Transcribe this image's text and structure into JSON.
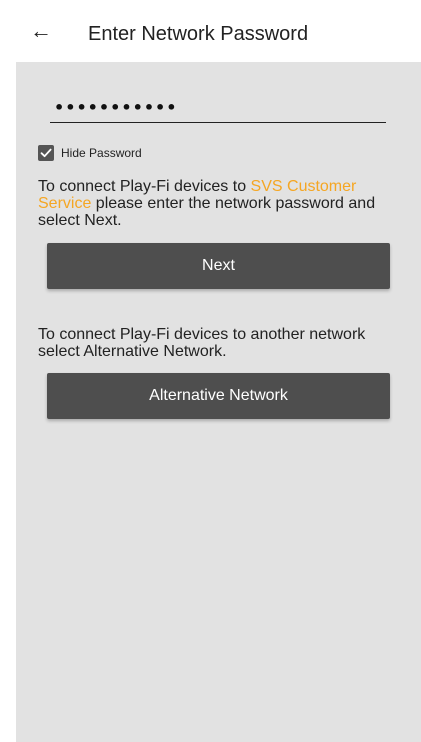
{
  "header": {
    "back_icon": "arrow-left-icon",
    "title": "Enter Network Password"
  },
  "password": {
    "value": "•••••••••••"
  },
  "hide_password": {
    "label": "Hide Password",
    "checked": true
  },
  "instructions": {
    "prefix": "To connect Play-Fi devices to ",
    "network_name": "SVS Customer Service",
    "suffix": " please enter the network password and select Next."
  },
  "next_button": {
    "label": "Next"
  },
  "alternative": {
    "text": "To connect Play-Fi devices to another network select Alternative Network.",
    "button_label": "Alternative Network"
  },
  "colors": {
    "accent": "#f5a623",
    "button_bg": "#4e4e4e",
    "panel_bg": "#e2e2e2"
  }
}
